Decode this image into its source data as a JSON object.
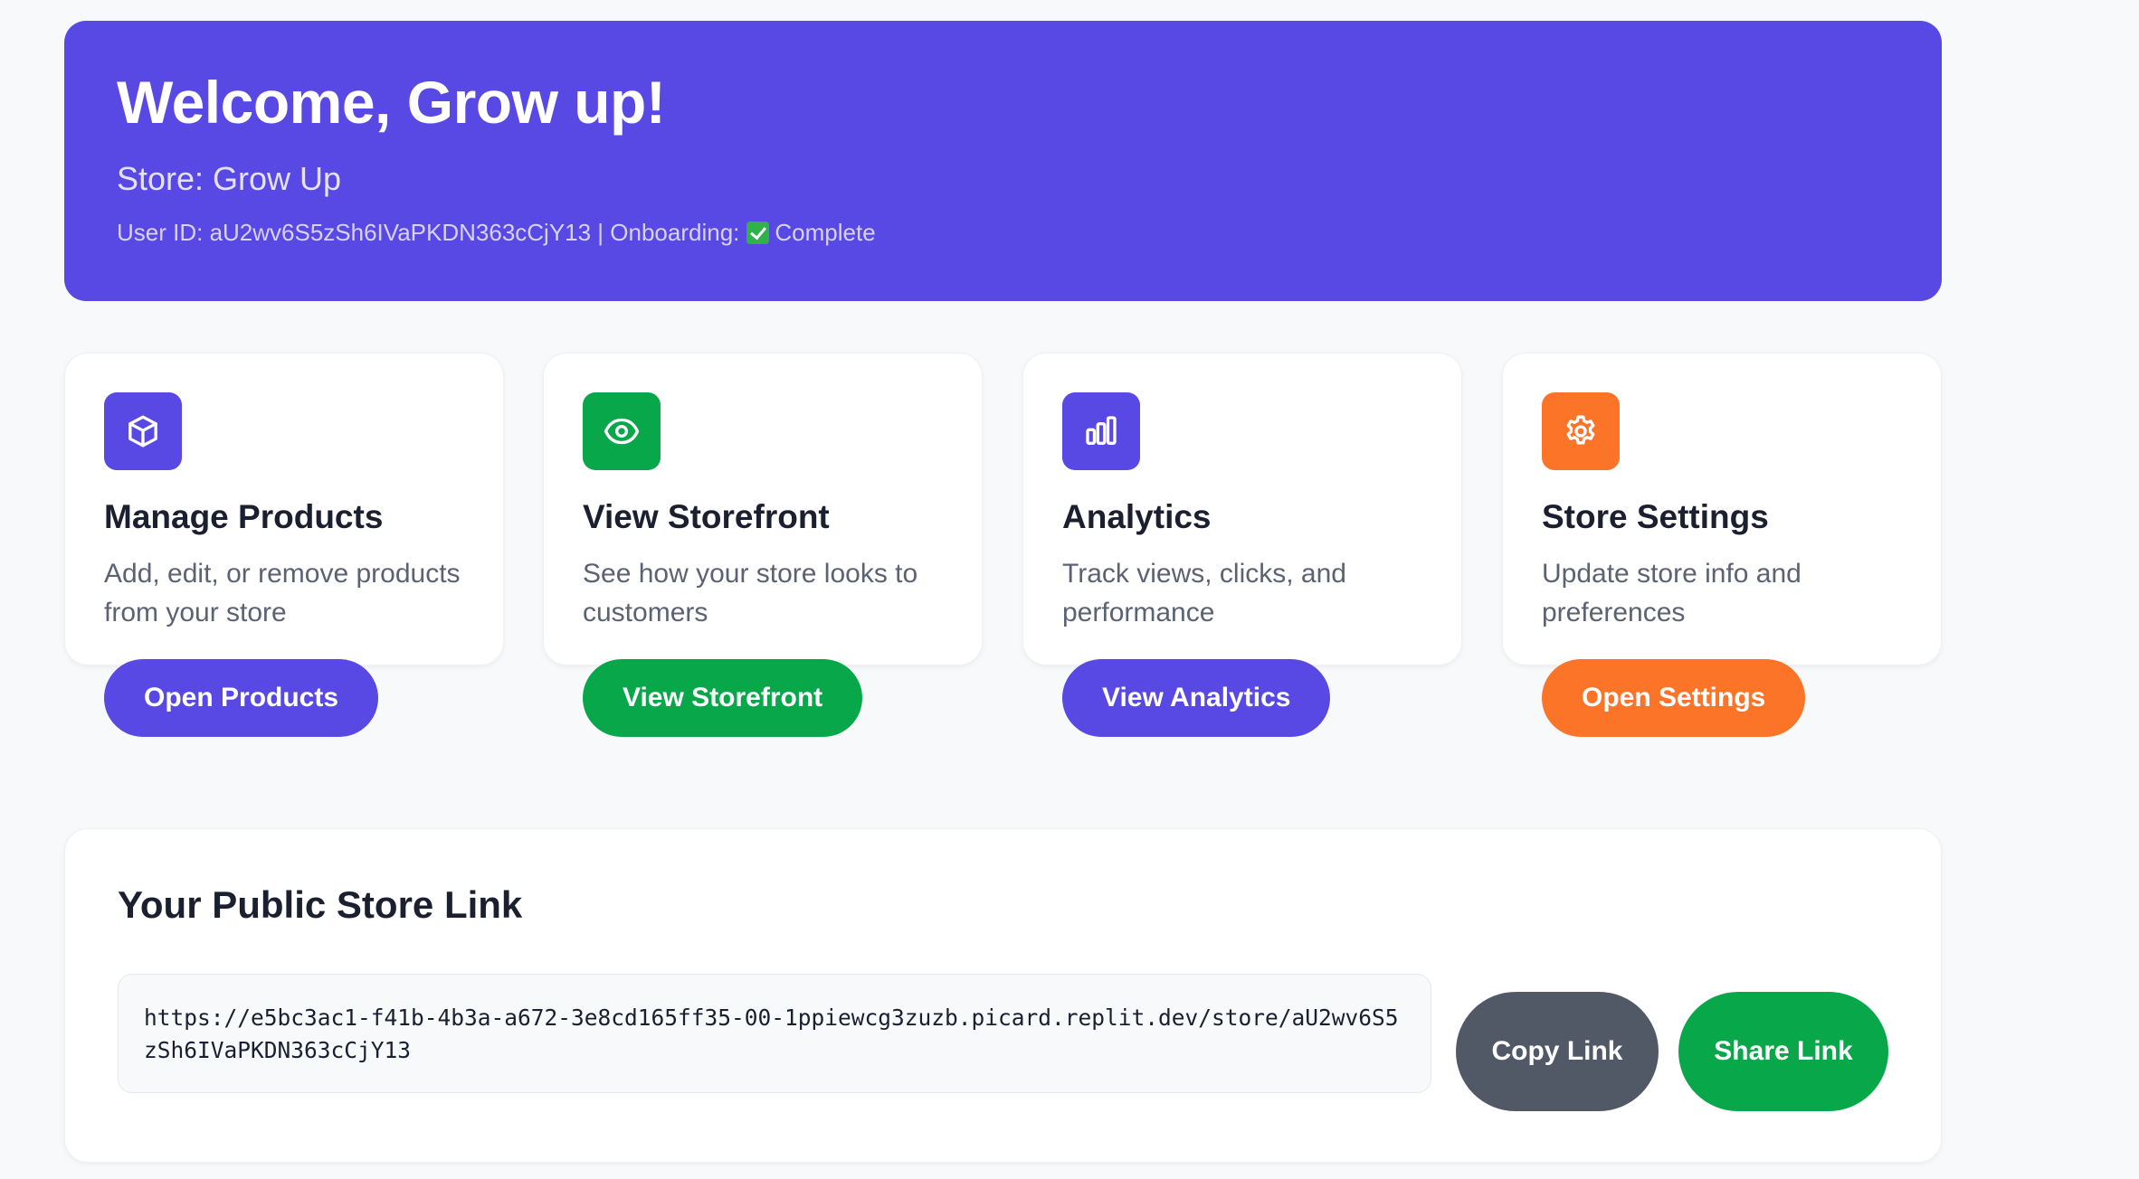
{
  "banner": {
    "title": "Welcome, Grow up!",
    "store_line": "Store: Grow Up",
    "user_id_line": "User ID: aU2wv6S5zSh6IVaPKDN363cCjY13 | Onboarding:",
    "onboarding_status": "Complete",
    "background_color": "#5849e5"
  },
  "cards": [
    {
      "icon": "cube-icon",
      "icon_color": "#5849e5",
      "title": "Manage Products",
      "description": "Add, edit, or remove products from your store",
      "button_label": "Open Products",
      "button_color": "#5849e5"
    },
    {
      "icon": "eye-icon",
      "icon_color": "#08a84a",
      "title": "View Storefront",
      "description": "See how your store looks to customers",
      "button_label": "View Storefront",
      "button_color": "#08a84a"
    },
    {
      "icon": "bar-chart-icon",
      "icon_color": "#5849e5",
      "title": "Analytics",
      "description": "Track views, clicks, and performance",
      "button_label": "View Analytics",
      "button_color": "#5849e5"
    },
    {
      "icon": "gear-icon",
      "icon_color": "#fb7427",
      "title": "Store Settings",
      "description": "Update store info and preferences",
      "button_label": "Open Settings",
      "button_color": "#fb7427"
    }
  ],
  "public_link": {
    "heading": "Your Public Store Link",
    "url": "https://e5bc3ac1-f41b-4b3a-a672-3e8cd165ff35-00-1ppiewcg3zuzb.picard.replit.dev/store/aU2wv6S5zSh6IVaPKDN363cCjY13",
    "copy_label": "Copy Link",
    "copy_color": "#525966",
    "share_label": "Share Link",
    "share_color": "#08a84a"
  }
}
